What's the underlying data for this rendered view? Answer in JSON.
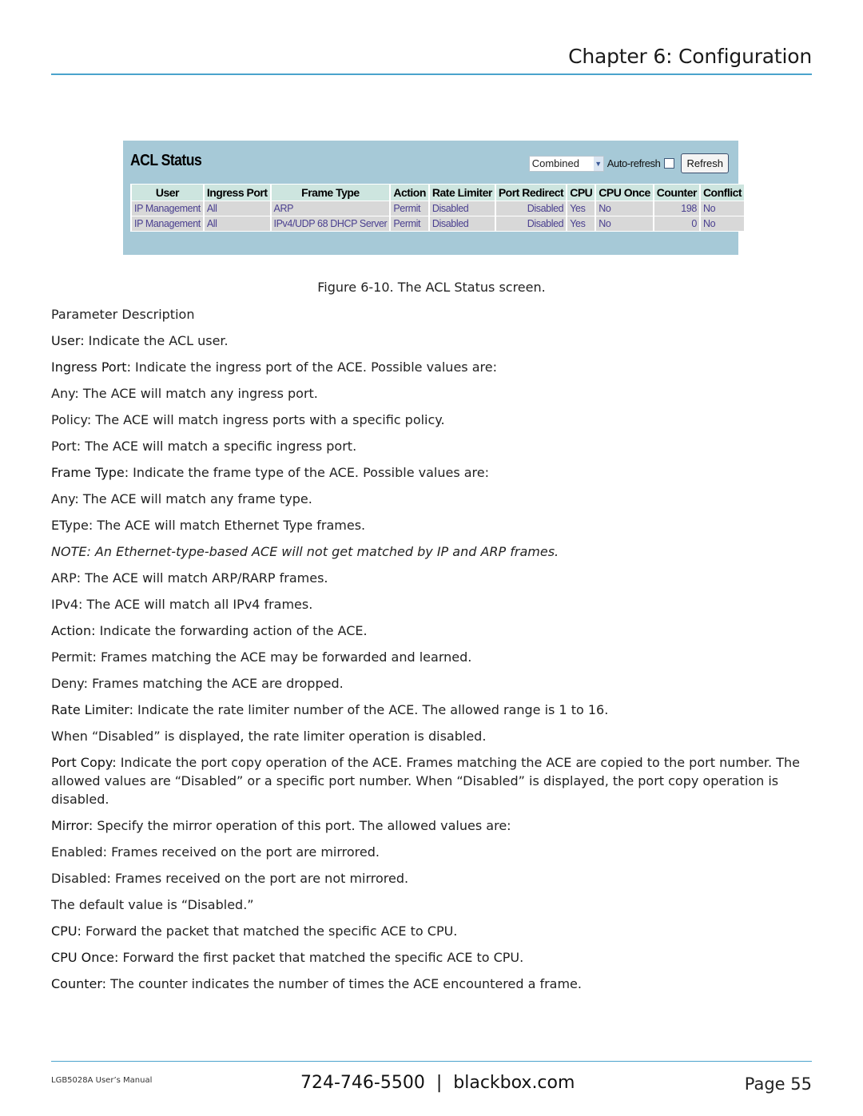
{
  "header": {
    "chapter_title": "Chapter 6: Configuration"
  },
  "acl_screen": {
    "title": "ACL Status",
    "select_value": "Combined",
    "auto_refresh_label": "Auto-refresh",
    "auto_refresh_checked": false,
    "refresh_label": "Refresh",
    "columns": [
      "User",
      "Ingress Port",
      "Frame Type",
      "Action",
      "Rate Limiter",
      "Port Redirect",
      "CPU",
      "CPU Once",
      "Counter",
      "Conflict"
    ],
    "rows": [
      [
        "IP Management",
        "All",
        "ARP",
        "Permit",
        "Disabled",
        "Disabled",
        "Yes",
        "No",
        "198",
        "No"
      ],
      [
        "IP Management",
        "All",
        "IPv4/UDP 68 DHCP Server",
        "Permit",
        "Disabled",
        "Disabled",
        "Yes",
        "No",
        "0",
        "No"
      ]
    ]
  },
  "caption": "Figure 6-10. The ACL Status screen.",
  "paragraphs": [
    {
      "label": "",
      "text": "Parameter Description"
    },
    {
      "label": "User:",
      "text": " Indicate the ACL user."
    },
    {
      "label": "Ingress Port:",
      "text": " Indicate the ingress port of the ACE. Possible values are:"
    },
    {
      "label": "",
      "text": "Any: The ACE will match any ingress port."
    },
    {
      "label": "",
      "text": "Policy: The ACE will match ingress ports with a specific policy."
    },
    {
      "label": "",
      "text": "Port: The ACE will match a specific ingress port."
    },
    {
      "label": "Frame Type:",
      "text": " Indicate the frame type of the ACE. Possible values are:"
    },
    {
      "label": "",
      "text": "Any: The ACE will match any frame type."
    },
    {
      "label": "",
      "text": "EType: The ACE will match Ethernet Type frames."
    },
    {
      "label": "",
      "text": "NOTE: An Ethernet-type-based ACE will not get matched by IP and ARP frames.",
      "italic": true
    },
    {
      "label": "",
      "text": "ARP: The ACE will match ARP/RARP frames."
    },
    {
      "label": "",
      "text": "IPv4: The ACE will match all IPv4 frames."
    },
    {
      "label": "Action:",
      "text": " Indicate the forwarding action of the ACE."
    },
    {
      "label": "",
      "text": "Permit: Frames matching the ACE may be forwarded and learned."
    },
    {
      "label": "",
      "text": "Deny: Frames matching the ACE are dropped."
    },
    {
      "label": "Rate Limiter:",
      "text": " Indicate the rate limiter number of the ACE. The allowed range is 1 to 16."
    },
    {
      "label": "",
      "text": "When “Disabled” is displayed, the rate limiter operation is disabled."
    },
    {
      "label": "Port Copy:",
      "text": " Indicate the port copy operation of the ACE. Frames matching the ACE are copied to the port number. The allowed values are “Disabled” or a specific port number. When “Disabled” is displayed, the port copy operation is disabled."
    },
    {
      "label": "Mirror:",
      "text": " Specify the mirror operation of this port. The allowed values are:"
    },
    {
      "label": "",
      "text": "Enabled: Frames received on the port are mirrored."
    },
    {
      "label": "",
      "text": "Disabled: Frames received on the port are not mirrored."
    },
    {
      "label": "",
      "text": "The default value is “Disabled.”"
    },
    {
      "label": "CPU:",
      "text": " Forward the packet that matched the specific ACE to CPU."
    },
    {
      "label": "CPU Once:",
      "text": " Forward the first packet that matched the specific ACE to CPU."
    },
    {
      "label": "Counter:",
      "text": " The counter indicates the number of times the ACE encountered a frame."
    }
  ],
  "footer": {
    "manual": "LGB5028A User’s Manual",
    "phone": "724-746-5500",
    "separator": "|",
    "website": "blackbox.com",
    "page": "Page 55"
  }
}
